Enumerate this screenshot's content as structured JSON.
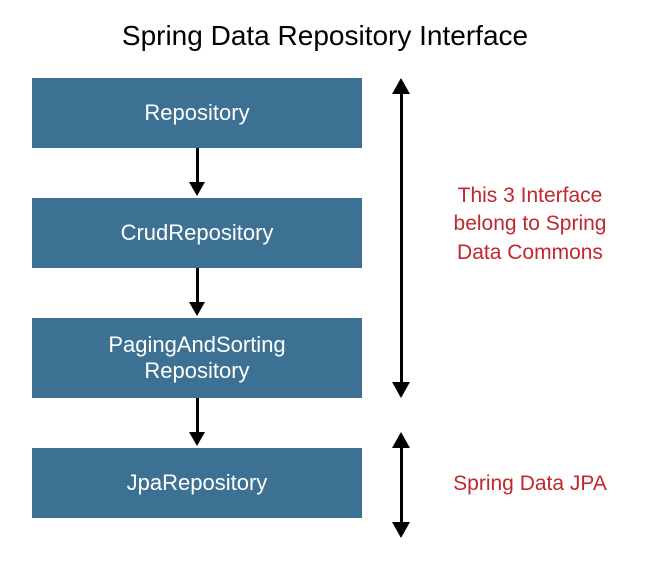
{
  "title": "Spring Data Repository Interface",
  "boxes": {
    "repository": "Repository",
    "crud": "CrudRepository",
    "paging_line1": "PagingAndSorting",
    "paging_line2": "Repository",
    "jpa": "JpaRepository"
  },
  "annotations": {
    "commons_line1": "This 3 Interface",
    "commons_line2": "belong to Spring",
    "commons_line3": "Data Commons",
    "jpa": "Spring Data JPA"
  }
}
